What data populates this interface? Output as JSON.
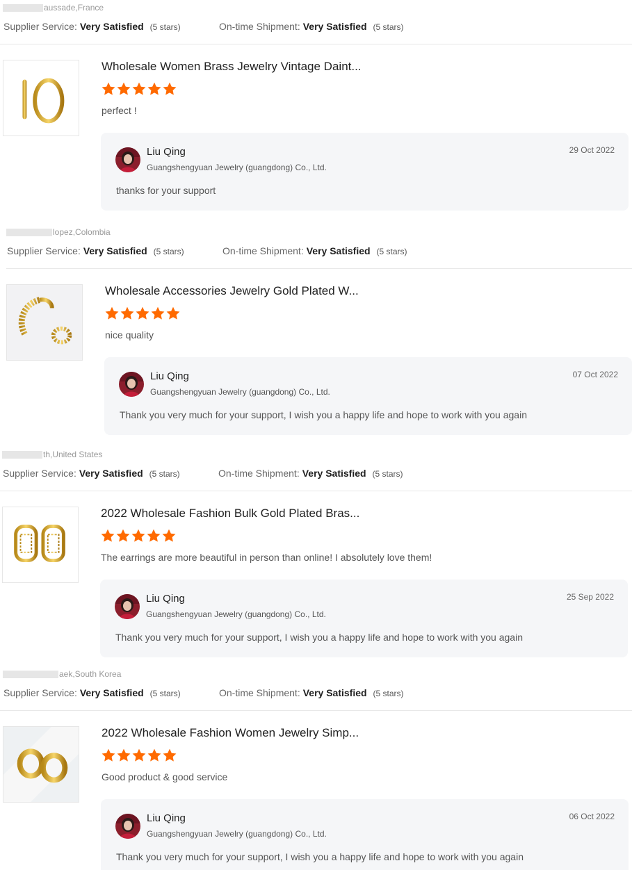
{
  "colors": {
    "star": "#ff6a00",
    "reply_bg": "#f5f6f8",
    "divider": "#e8e8e8"
  },
  "rating_labels": {
    "supplier": "Supplier Service:",
    "shipment": "On-time Shipment:",
    "value": "Very Satisfied",
    "stars_text": "(5 stars)"
  },
  "reviews": [
    {
      "buyer_suffix": "aussade,France",
      "product_title": "Wholesale Women Brass Jewelry Vintage Daint...",
      "rating": 5,
      "comment": "perfect !",
      "product_icon": "gold-hoop-earrings-image",
      "reply": {
        "name": "Liu Qing",
        "company": "Guangshengyuan Jewelry (guangdong) Co., Ltd.",
        "date": "29 Oct 2022",
        "text": "thanks for your support"
      }
    },
    {
      "buyer_suffix": "lopez,Colombia",
      "product_title": "Wholesale Accessories Jewelry Gold Plated W...",
      "rating": 5,
      "comment": "nice quality",
      "product_icon": "gold-bangle-ring-image",
      "reply": {
        "name": "Liu Qing",
        "company": "Guangshengyuan Jewelry (guangdong) Co., Ltd.",
        "date": "07 Oct 2022",
        "text": "Thank you very much for your support, I wish you a happy life and hope to work with you again"
      }
    },
    {
      "buyer_suffix": "th,United States",
      "product_title": "2022 Wholesale Fashion Bulk Gold Plated Bras...",
      "rating": 5,
      "comment": "The earrings are more beautiful in person than online! I absolutely love them!",
      "product_icon": "gold-huggie-earrings-image",
      "reply": {
        "name": "Liu Qing",
        "company": "Guangshengyuan Jewelry (guangdong) Co., Ltd.",
        "date": "25 Sep 2022",
        "text": "Thank you very much for your support, I wish you a happy life and hope to work with you again"
      }
    },
    {
      "buyer_suffix": "aek,South Korea",
      "product_title": "2022 Wholesale Fashion Women Jewelry Simp...",
      "rating": 5,
      "comment": "Good product & good service",
      "product_icon": "gold-chunky-hoops-image",
      "reply": {
        "name": "Liu Qing",
        "company": "Guangshengyuan Jewelry (guangdong) Co., Ltd.",
        "date": "06 Oct 2022",
        "text": "Thank you very much for your support, I wish you a happy life and hope to work with you again"
      }
    }
  ]
}
